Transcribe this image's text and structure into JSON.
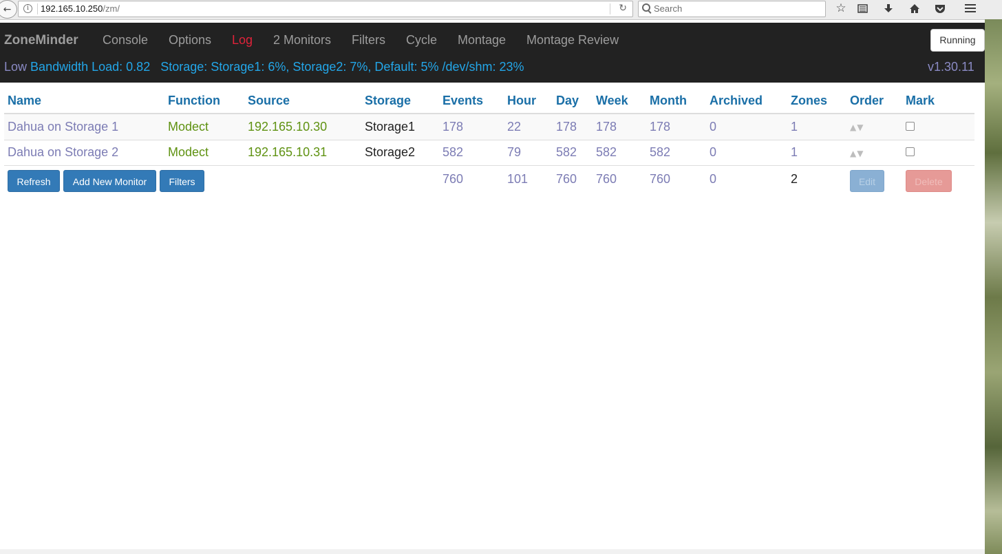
{
  "browser": {
    "url_host": "192.165.10.250",
    "url_path": "/zm/",
    "search_placeholder": "Search"
  },
  "navbar": {
    "brand": "ZoneMinder",
    "items": [
      {
        "label": "Console"
      },
      {
        "label": "Options"
      },
      {
        "label": "Log"
      },
      {
        "label": "2 Monitors"
      },
      {
        "label": "Filters"
      },
      {
        "label": "Cycle"
      },
      {
        "label": "Montage"
      },
      {
        "label": "Montage Review"
      }
    ],
    "active_item": "Log",
    "state_button": "Running",
    "bandwidth_prefix": "Low",
    "bandwidth_link": "Bandwidth",
    "load": "Load: 0.82",
    "storage": "Storage: Storage1: 6%, Storage2: 7%, Default: 5% /dev/shm: 23%",
    "version": "v1.30.11"
  },
  "table": {
    "headers": [
      "Name",
      "Function",
      "Source",
      "Storage",
      "Events",
      "Hour",
      "Day",
      "Week",
      "Month",
      "Archived",
      "Zones",
      "Order",
      "Mark"
    ],
    "rows": [
      {
        "name": "Dahua on Storage 1",
        "function": "Modect",
        "source": "192.165.10.30",
        "storage": "Storage1",
        "events": "178",
        "hour": "22",
        "day": "178",
        "week": "178",
        "month": "178",
        "archived": "0",
        "zones": "1"
      },
      {
        "name": "Dahua on Storage 2",
        "function": "Modect",
        "source": "192.165.10.31",
        "storage": "Storage2",
        "events": "582",
        "hour": "79",
        "day": "582",
        "week": "582",
        "month": "582",
        "archived": "0",
        "zones": "1"
      }
    ],
    "totals": {
      "events": "760",
      "hour": "101",
      "day": "760",
      "week": "760",
      "month": "760",
      "archived": "0",
      "zones": "2"
    },
    "buttons": {
      "refresh": "Refresh",
      "add_monitor": "Add New Monitor",
      "filters": "Filters",
      "edit": "Edit",
      "delete": "Delete"
    }
  },
  "colors": {
    "navbar_bg": "#222222",
    "header_link": "#1a6fa7",
    "function_green": "#5f9212",
    "link_purple": "#7c7cb4",
    "active_red": "#e0223a",
    "primary_button": "#337ab7",
    "status_blue": "#23a6e8"
  }
}
